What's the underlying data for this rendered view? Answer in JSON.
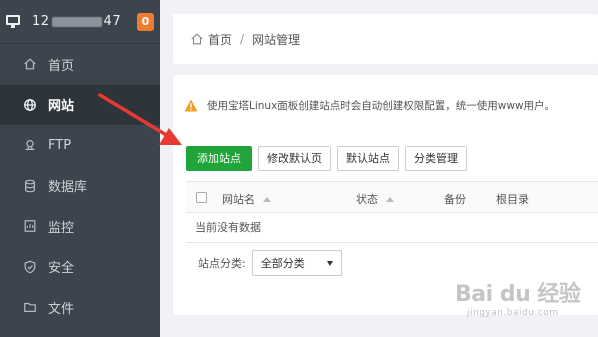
{
  "sidebar": {
    "ip_prefix": "12",
    "ip_suffix": "47",
    "badge": "0",
    "items": [
      {
        "label": "首页",
        "icon": "home-icon"
      },
      {
        "label": "网站",
        "icon": "globe-icon",
        "active": true
      },
      {
        "label": "FTP",
        "icon": "ftp-icon"
      },
      {
        "label": "数据库",
        "icon": "database-icon"
      },
      {
        "label": "监控",
        "icon": "monitor-chart-icon"
      },
      {
        "label": "安全",
        "icon": "shield-icon"
      },
      {
        "label": "文件",
        "icon": "folder-icon"
      }
    ]
  },
  "breadcrumb": {
    "home": "首页",
    "separator": "/",
    "current": "网站管理"
  },
  "notice": "使用宝塔Linux面板创建站点时会自动创建权限配置，统一使用www用户。",
  "buttons": {
    "add_site": "添加站点",
    "edit_default_page": "修改默认页",
    "default_site": "默认站点",
    "category_manage": "分类管理"
  },
  "table": {
    "columns": [
      "网站名",
      "状态",
      "备份",
      "根目录"
    ],
    "empty_text": "当前没有数据"
  },
  "filter": {
    "label": "站点分类:",
    "selected": "全部分类"
  },
  "watermark": {
    "main": "Bai du 经验",
    "sub": "jingyan.baidu.com"
  },
  "colors": {
    "sidebar_bg": "#3c444d",
    "primary_green": "#20a53a",
    "badge_orange": "#f07d2e",
    "annotation_red": "#e83a32"
  }
}
